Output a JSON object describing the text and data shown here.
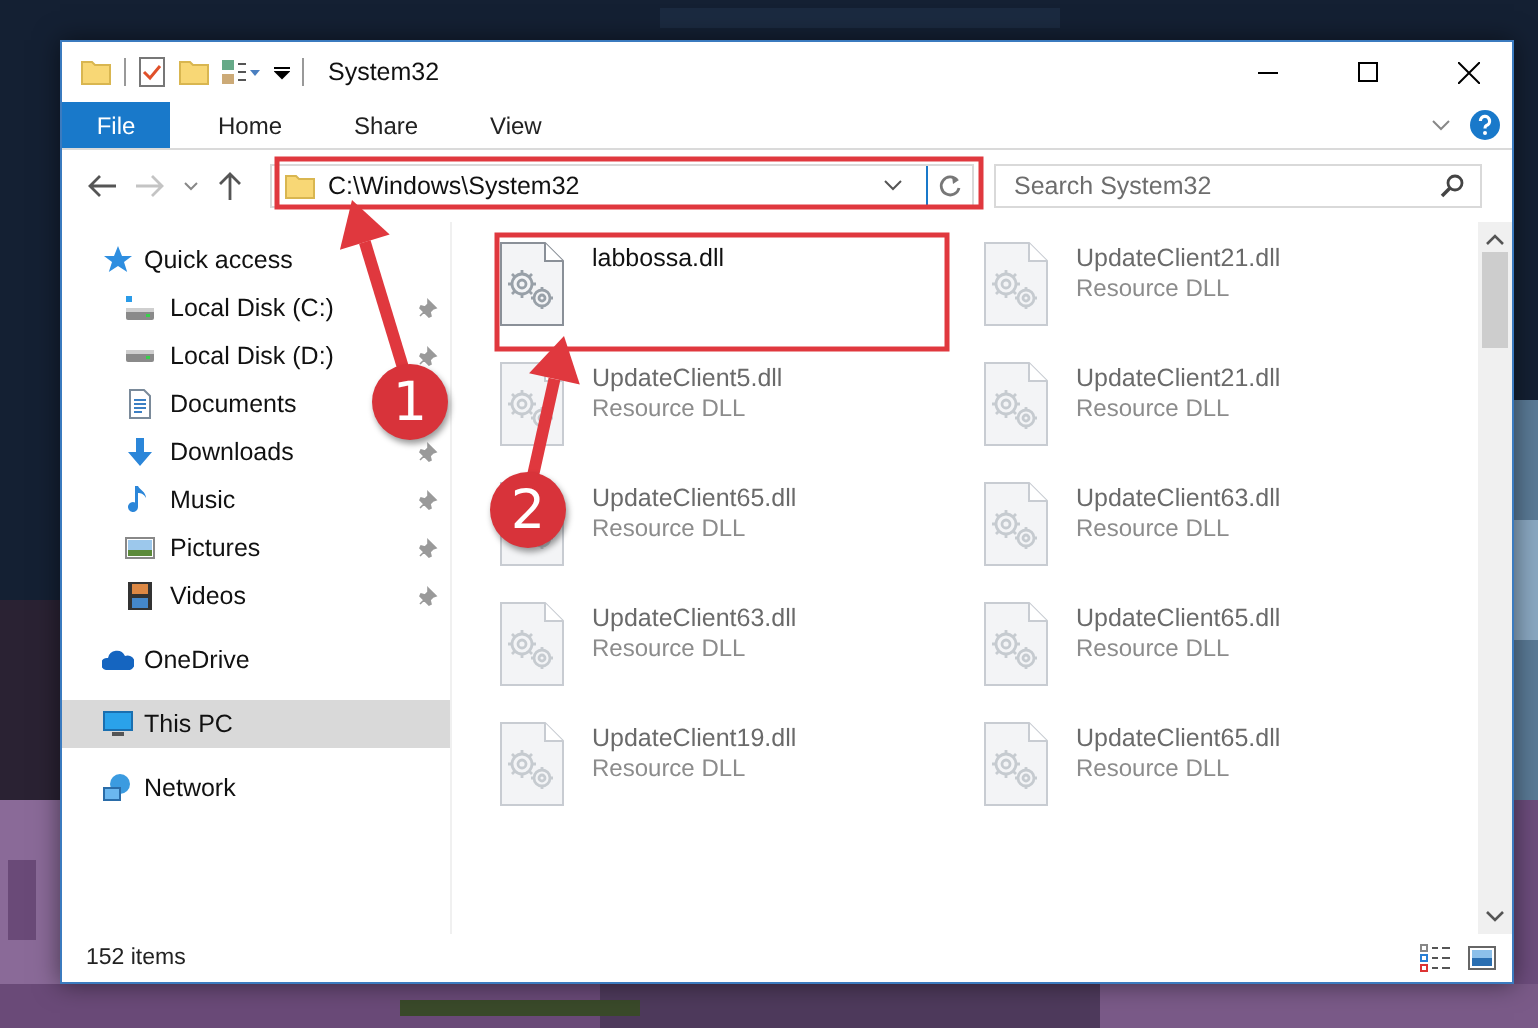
{
  "window": {
    "title": "System32"
  },
  "ribbon": {
    "tabs": [
      {
        "label": "File",
        "kind": "file",
        "selected": false
      },
      {
        "label": "Home",
        "kind": "tab",
        "selected": false
      },
      {
        "label": "Share",
        "kind": "tab",
        "selected": false
      },
      {
        "label": "View",
        "kind": "tab",
        "selected": false
      }
    ]
  },
  "address": {
    "path": "C:\\Windows\\System32"
  },
  "search": {
    "placeholder": "Search System32"
  },
  "navigation": [
    {
      "label": "Quick access",
      "kind": "star",
      "selected": false,
      "children": [
        {
          "label": "Local Disk (C:)",
          "kind": "system-drive",
          "pinned": true,
          "selected": false
        },
        {
          "label": "Local Disk (D:)",
          "kind": "drive",
          "pinned": true,
          "selected": false
        },
        {
          "label": "Documents",
          "kind": "documents",
          "pinned": false,
          "selected": false
        },
        {
          "label": "Downloads",
          "kind": "downloads",
          "pinned": true,
          "selected": false
        },
        {
          "label": "Music",
          "kind": "music",
          "pinned": true,
          "selected": false
        },
        {
          "label": "Pictures",
          "kind": "pictures",
          "pinned": true,
          "selected": false
        },
        {
          "label": "Videos",
          "kind": "videos",
          "pinned": true,
          "selected": false
        }
      ]
    },
    {
      "label": "OneDrive",
      "kind": "cloud",
      "selected": false
    },
    {
      "label": "This PC",
      "kind": "computer",
      "selected": true
    },
    {
      "label": "Network",
      "kind": "network",
      "selected": false
    }
  ],
  "files": [
    {
      "name": "labbossa.dll",
      "blurred": false
    },
    {
      "name": "UpdateClient21.dll",
      "type": "Resource DLL",
      "blurred": true
    },
    {
      "name": "UpdateClient5.dll",
      "type": "Resource DLL",
      "blurred": true
    },
    {
      "name": "UpdateClient21.dll",
      "type": "Resource DLL",
      "blurred": true
    },
    {
      "name": "UpdateClient65.dll",
      "type": "Resource DLL",
      "blurred": true
    },
    {
      "name": "UpdateClient63.dll",
      "type": "Resource DLL",
      "blurred": true
    },
    {
      "name": "UpdateClient63.dll",
      "type": "Resource DLL",
      "blurred": true
    },
    {
      "name": "UpdateClient65.dll",
      "type": "Resource DLL",
      "blurred": true
    },
    {
      "name": "UpdateClient19.dll",
      "type": "Resource DLL",
      "blurred": true
    },
    {
      "name": "UpdateClient65.dll",
      "type": "Resource DLL",
      "blurred": true
    }
  ],
  "status_bar": {
    "item_count": "152 items"
  },
  "annotations": [
    {
      "number": "1"
    },
    {
      "number": "2"
    }
  ]
}
